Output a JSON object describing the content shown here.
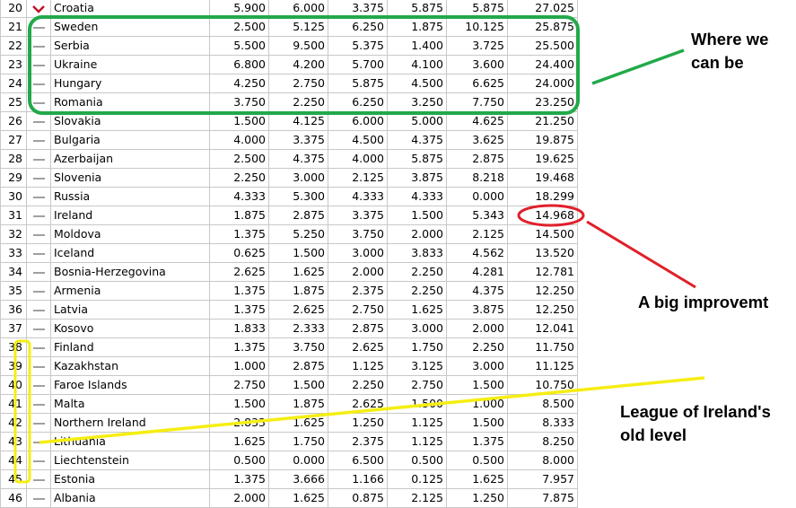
{
  "table": {
    "rows": [
      {
        "rank": "20",
        "trend": "down",
        "country": "Croatia",
        "v1": "5.900",
        "v2": "6.000",
        "v3": "3.375",
        "v4": "5.875",
        "v5": "5.875",
        "total": "27.025"
      },
      {
        "rank": "21",
        "trend": "same",
        "country": "Sweden",
        "v1": "2.500",
        "v2": "5.125",
        "v3": "6.250",
        "v4": "1.875",
        "v5": "10.125",
        "total": "25.875"
      },
      {
        "rank": "22",
        "trend": "same",
        "country": "Serbia",
        "v1": "5.500",
        "v2": "9.500",
        "v3": "5.375",
        "v4": "1.400",
        "v5": "3.725",
        "total": "25.500"
      },
      {
        "rank": "23",
        "trend": "same",
        "country": "Ukraine",
        "v1": "6.800",
        "v2": "4.200",
        "v3": "5.700",
        "v4": "4.100",
        "v5": "3.600",
        "total": "24.400"
      },
      {
        "rank": "24",
        "trend": "same",
        "country": "Hungary",
        "v1": "4.250",
        "v2": "2.750",
        "v3": "5.875",
        "v4": "4.500",
        "v5": "6.625",
        "total": "24.000"
      },
      {
        "rank": "25",
        "trend": "same",
        "country": "Romania",
        "v1": "3.750",
        "v2": "2.250",
        "v3": "6.250",
        "v4": "3.250",
        "v5": "7.750",
        "total": "23.250"
      },
      {
        "rank": "26",
        "trend": "same",
        "country": "Slovakia",
        "v1": "1.500",
        "v2": "4.125",
        "v3": "6.000",
        "v4": "5.000",
        "v5": "4.625",
        "total": "21.250"
      },
      {
        "rank": "27",
        "trend": "same",
        "country": "Bulgaria",
        "v1": "4.000",
        "v2": "3.375",
        "v3": "4.500",
        "v4": "4.375",
        "v5": "3.625",
        "total": "19.875"
      },
      {
        "rank": "28",
        "trend": "same",
        "country": "Azerbaijan",
        "v1": "2.500",
        "v2": "4.375",
        "v3": "4.000",
        "v4": "5.875",
        "v5": "2.875",
        "total": "19.625"
      },
      {
        "rank": "29",
        "trend": "same",
        "country": "Slovenia",
        "v1": "2.250",
        "v2": "3.000",
        "v3": "2.125",
        "v4": "3.875",
        "v5": "8.218",
        "total": "19.468"
      },
      {
        "rank": "30",
        "trend": "same",
        "country": "Russia",
        "v1": "4.333",
        "v2": "5.300",
        "v3": "4.333",
        "v4": "4.333",
        "v5": "0.000",
        "total": "18.299"
      },
      {
        "rank": "31",
        "trend": "same",
        "country": "Ireland",
        "v1": "1.875",
        "v2": "2.875",
        "v3": "3.375",
        "v4": "1.500",
        "v5": "5.343",
        "total": "14.968"
      },
      {
        "rank": "32",
        "trend": "same",
        "country": "Moldova",
        "v1": "1.375",
        "v2": "5.250",
        "v3": "3.750",
        "v4": "2.000",
        "v5": "2.125",
        "total": "14.500"
      },
      {
        "rank": "33",
        "trend": "same",
        "country": "Iceland",
        "v1": "0.625",
        "v2": "1.500",
        "v3": "3.000",
        "v4": "3.833",
        "v5": "4.562",
        "total": "13.520"
      },
      {
        "rank": "34",
        "trend": "same",
        "country": "Bosnia-Herzegovina",
        "v1": "2.625",
        "v2": "1.625",
        "v3": "2.000",
        "v4": "2.250",
        "v5": "4.281",
        "total": "12.781"
      },
      {
        "rank": "35",
        "trend": "same",
        "country": "Armenia",
        "v1": "1.375",
        "v2": "1.875",
        "v3": "2.375",
        "v4": "2.250",
        "v5": "4.375",
        "total": "12.250"
      },
      {
        "rank": "36",
        "trend": "same",
        "country": "Latvia",
        "v1": "1.375",
        "v2": "2.625",
        "v3": "2.750",
        "v4": "1.625",
        "v5": "3.875",
        "total": "12.250"
      },
      {
        "rank": "37",
        "trend": "same",
        "country": "Kosovo",
        "v1": "1.833",
        "v2": "2.333",
        "v3": "2.875",
        "v4": "3.000",
        "v5": "2.000",
        "total": "12.041"
      },
      {
        "rank": "38",
        "trend": "same",
        "country": "Finland",
        "v1": "1.375",
        "v2": "3.750",
        "v3": "2.625",
        "v4": "1.750",
        "v5": "2.250",
        "total": "11.750"
      },
      {
        "rank": "39",
        "trend": "same",
        "country": "Kazakhstan",
        "v1": "1.000",
        "v2": "2.875",
        "v3": "1.125",
        "v4": "3.125",
        "v5": "3.000",
        "total": "11.125"
      },
      {
        "rank": "40",
        "trend": "same",
        "country": "Faroe Islands",
        "v1": "2.750",
        "v2": "1.500",
        "v3": "2.250",
        "v4": "2.750",
        "v5": "1.500",
        "total": "10.750"
      },
      {
        "rank": "41",
        "trend": "same",
        "country": "Malta",
        "v1": "1.500",
        "v2": "1.875",
        "v3": "2.625",
        "v4": "1.500",
        "v5": "1.000",
        "total": "8.500"
      },
      {
        "rank": "42",
        "trend": "same",
        "country": "Northern Ireland",
        "v1": "2.833",
        "v2": "1.625",
        "v3": "1.250",
        "v4": "1.125",
        "v5": "1.500",
        "total": "8.333"
      },
      {
        "rank": "43",
        "trend": "same",
        "country": "Lithuania",
        "v1": "1.625",
        "v2": "1.750",
        "v3": "2.375",
        "v4": "1.125",
        "v5": "1.375",
        "total": "8.250"
      },
      {
        "rank": "44",
        "trend": "same",
        "country": "Liechtenstein",
        "v1": "0.500",
        "v2": "0.000",
        "v3": "6.500",
        "v4": "0.500",
        "v5": "0.500",
        "total": "8.000"
      },
      {
        "rank": "45",
        "trend": "same",
        "country": "Estonia",
        "v1": "1.375",
        "v2": "3.666",
        "v3": "1.166",
        "v4": "0.125",
        "v5": "1.625",
        "total": "7.957"
      },
      {
        "rank": "46",
        "trend": "same",
        "country": "Albania",
        "v1": "2.000",
        "v2": "1.625",
        "v3": "0.875",
        "v4": "2.125",
        "v5": "1.250",
        "total": "7.875"
      }
    ]
  },
  "annotations": {
    "green_note": "Where we can be",
    "red_note": "A big improvemt",
    "yellow_note": "League of Ireland's old level"
  },
  "colors": {
    "green": "#22a94a",
    "red": "#e0202a",
    "yellow": "#f5ee12",
    "chevron": "#c0102a",
    "grid": "#c8c8c8",
    "dash": "#a0a0a0"
  }
}
